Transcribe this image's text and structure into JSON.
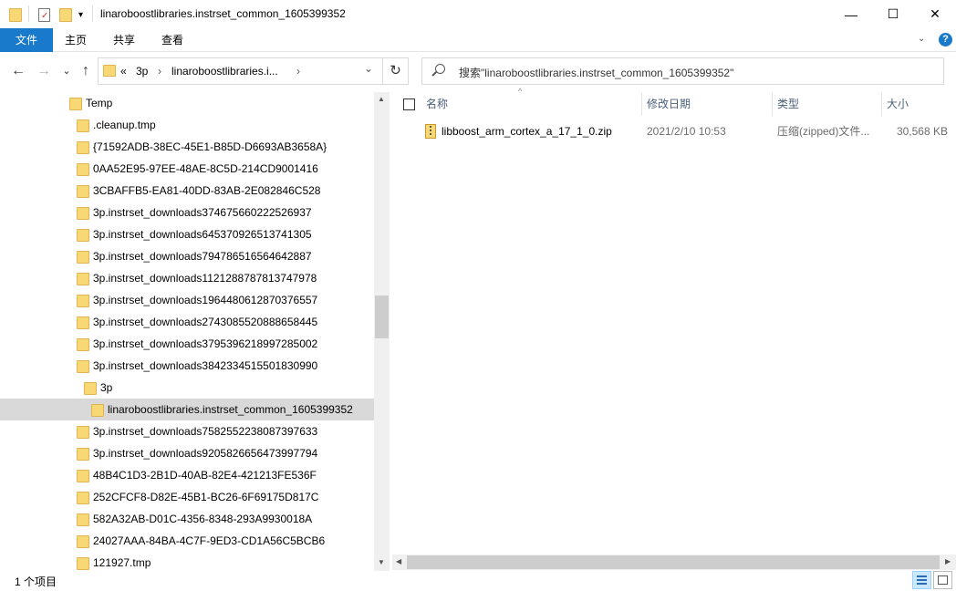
{
  "window": {
    "title": "linaroboostlibraries.instrset_common_1605399352",
    "controls": {
      "minimize": "—",
      "maximize": "☐",
      "close": "✕"
    }
  },
  "quick_access": {
    "dropdown": "▾"
  },
  "ribbon": {
    "tabs": [
      "文件",
      "主页",
      "共享",
      "查看"
    ],
    "expand_icon": "chevron-down-icon",
    "help": "?"
  },
  "nav_buttons": {
    "back": "←",
    "forward": "→",
    "recent": "⌄",
    "up": "↑"
  },
  "address": {
    "overflow": "«",
    "segments": [
      "3p",
      "linaroboostlibraries.i..."
    ],
    "separator": "›",
    "dropdown": "⌄",
    "refresh": "↻"
  },
  "search": {
    "placeholder": "搜索\"linaroboostlibraries.instrset_common_1605399352\""
  },
  "tree": [
    {
      "label": "Temp",
      "level": 0
    },
    {
      "label": ".cleanup.tmp",
      "level": 1
    },
    {
      "label": "{71592ADB-38EC-45E1-B85D-D6693AB3658A}",
      "level": 1
    },
    {
      "label": "0AA52E95-97EE-48AE-8C5D-214CD9001416",
      "level": 1
    },
    {
      "label": "3CBAFFB5-EA81-40DD-83AB-2E082846C528",
      "level": 1
    },
    {
      "label": "3p.instrset_downloads374675660222526937",
      "level": 1
    },
    {
      "label": "3p.instrset_downloads645370926513741305",
      "level": 1
    },
    {
      "label": "3p.instrset_downloads794786516564642887",
      "level": 1
    },
    {
      "label": "3p.instrset_downloads1121288787813747978",
      "level": 1
    },
    {
      "label": "3p.instrset_downloads1964480612870376557",
      "level": 1
    },
    {
      "label": "3p.instrset_downloads2743085520888658445",
      "level": 1
    },
    {
      "label": "3p.instrset_downloads3795396218997285002",
      "level": 1
    },
    {
      "label": "3p.instrset_downloads3842334515501830990",
      "level": 1
    },
    {
      "label": "3p",
      "level": 2
    },
    {
      "label": "linaroboostlibraries.instrset_common_1605399352",
      "level": 3,
      "selected": true
    },
    {
      "label": "3p.instrset_downloads7582552238087397633",
      "level": 1
    },
    {
      "label": "3p.instrset_downloads9205826656473997794",
      "level": 1
    },
    {
      "label": "48B4C1D3-2B1D-40AB-82E4-421213FE536F",
      "level": 1
    },
    {
      "label": "252CFCF8-D82E-45B1-BC26-6F69175D817C",
      "level": 1
    },
    {
      "label": "582A32AB-D01C-4356-8348-293A9930018A",
      "level": 1
    },
    {
      "label": "24027AAA-84BA-4C7F-9ED3-CD1A56C5BCB6",
      "level": 1
    },
    {
      "label": "121927.tmp",
      "level": 1
    }
  ],
  "columns": {
    "name": "名称",
    "modified": "修改日期",
    "type": "类型",
    "size": "大小"
  },
  "files": [
    {
      "name": "libboost_arm_cortex_a_17_1_0.zip",
      "modified": "2021/2/10 10:53",
      "type": "压缩(zipped)文件...",
      "size": "30,568 KB"
    }
  ],
  "status": {
    "items": "1 个项目"
  },
  "colors": {
    "accent": "#1979ca",
    "selected_row": "#d9d9d9",
    "folder": "#f8d775"
  }
}
